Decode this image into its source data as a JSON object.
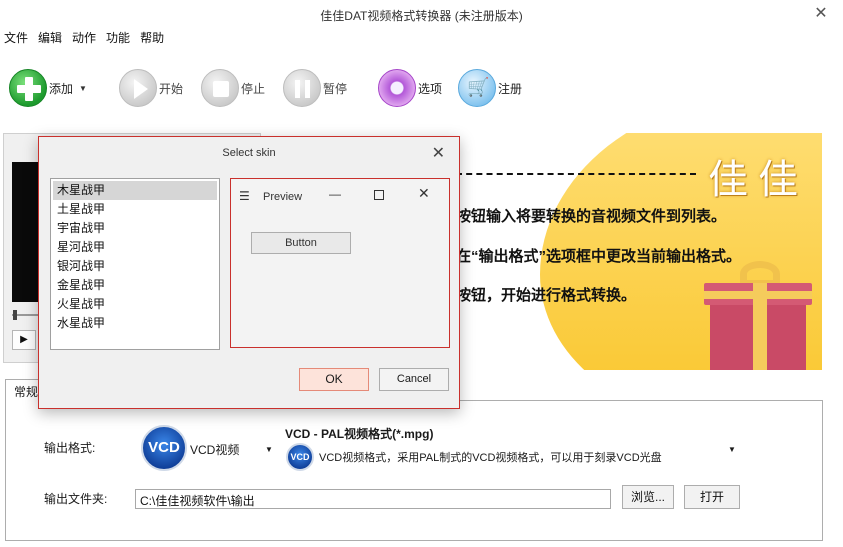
{
  "window": {
    "title": "佳佳DAT视频格式转换器  (未注册版本)",
    "close_glyph": "✕"
  },
  "menu": [
    "文件",
    "编辑",
    "动作",
    "功能",
    "帮助"
  ],
  "toolbar": {
    "add": "添加",
    "start": "开始",
    "stop": "停止",
    "pause": "暂停",
    "options": "选项",
    "register": "注册"
  },
  "player": {
    "play_glyph": "▶"
  },
  "banner": {
    "logo": "佳佳",
    "line1": "按钮输入将要转换的音视频文件到列表。",
    "line2": "在“输出格式”选项框中更改当前输出格式。",
    "line3": "按钮，开始进行格式转换。"
  },
  "settings": {
    "tab_label": "常规",
    "format_label": "输出格式:",
    "format_badge": "VCD",
    "format_name": "VCD视频",
    "profile_title": "VCD - PAL视频格式(*.mpg)",
    "profile_desc": "VCD视频格式，采用PAL制式的VCD视频格式，可以用于刻录VCD光盘",
    "output_label": "输出文件夹:",
    "output_path": "C:\\佳佳视频软件\\输出",
    "browse": "浏览...",
    "open": "打开"
  },
  "dialog": {
    "title": "Select skin",
    "close_glyph": "✕",
    "skins": [
      "木星战甲",
      "土星战甲",
      "宇宙战甲",
      "星河战甲",
      "银河战甲",
      "金星战甲",
      "火星战甲",
      "水星战甲"
    ],
    "selected_index": 0,
    "preview": {
      "title": "Preview",
      "min_glyph": "—",
      "close_glyph": "✕",
      "button": "Button"
    },
    "ok": "OK",
    "cancel": "Cancel"
  },
  "colors": {
    "dialog_border": "#c9302c",
    "banner_yellow": "#f9c52a",
    "ok_fill": "#fde3da"
  }
}
